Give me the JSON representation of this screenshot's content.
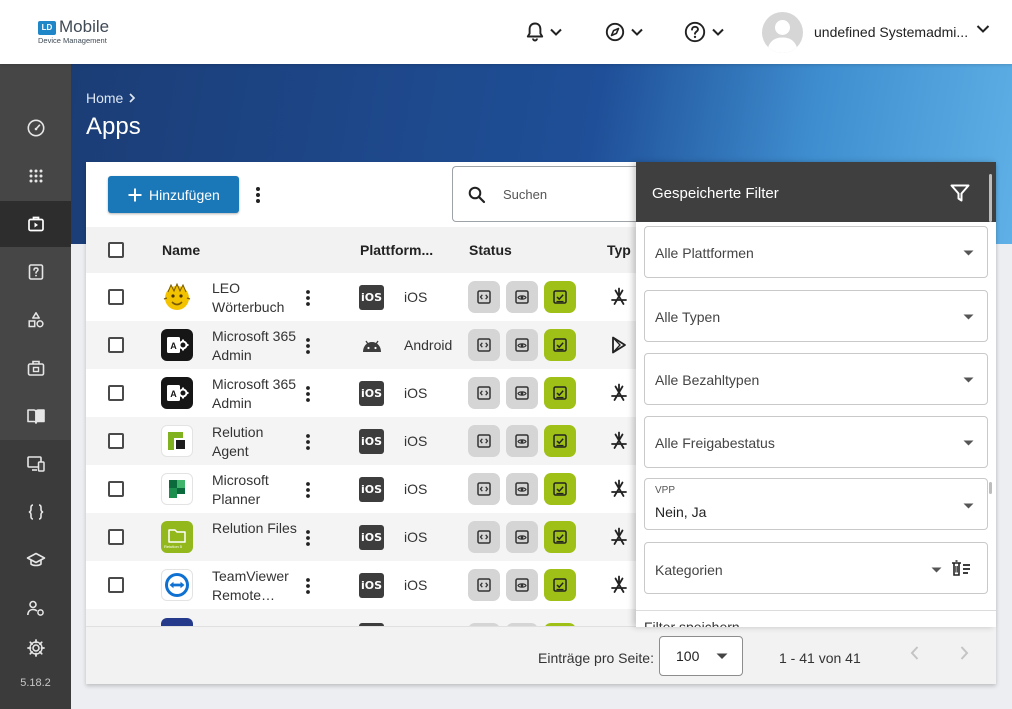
{
  "brand": {
    "logo_mark": "LD",
    "name": "Mobile",
    "subtitle": "Device Management"
  },
  "topbar": {
    "notifications_icon": "bell-icon",
    "compass_icon": "compass-icon",
    "help_icon": "help-icon",
    "user_name": "undefined Systemadmi..."
  },
  "sidebar": {
    "items": [
      {
        "name": "dashboard",
        "icon": "speedometer-icon"
      },
      {
        "name": "apps-grid",
        "icon": "grid-icon"
      },
      {
        "name": "apps",
        "icon": "app-store-icon",
        "active": true
      },
      {
        "name": "questions",
        "icon": "question-box-icon"
      },
      {
        "name": "shapes",
        "icon": "shapes-icon"
      },
      {
        "name": "briefcase",
        "icon": "briefcase-icon"
      },
      {
        "name": "book",
        "icon": "book-icon"
      },
      {
        "name": "devices",
        "icon": "device-icon"
      },
      {
        "name": "code",
        "icon": "braces-icon"
      },
      {
        "name": "education",
        "icon": "graduation-cap-icon"
      },
      {
        "name": "users",
        "icon": "users-icon"
      },
      {
        "name": "settings",
        "icon": "gear-icon"
      }
    ],
    "version": "5.18.2"
  },
  "header": {
    "breadcrumb_home": "Home",
    "title": "Apps"
  },
  "toolbar": {
    "add_label": "Hinzufügen",
    "search_placeholder": "Suchen"
  },
  "table": {
    "columns": {
      "name": "Name",
      "platform": "Plattform...",
      "status": "Status",
      "type": "Typ"
    },
    "rows": [
      {
        "name": "LEO Wörterbuch",
        "platform_badge": "iOS",
        "platform": "iOS",
        "type_icon": "app-store-icon",
        "app_icon": "leo-icon"
      },
      {
        "name": "Microsoft 365 Admin",
        "platform_badge": "",
        "platform": "Android",
        "type_icon": "play-store-icon",
        "app_icon": "ms365-admin-icon"
      },
      {
        "name": "Microsoft 365 Admin",
        "platform_badge": "iOS",
        "platform": "iOS",
        "type_icon": "app-store-icon",
        "app_icon": "ms365-admin-icon"
      },
      {
        "name": "Relution Agent",
        "platform_badge": "iOS",
        "platform": "iOS",
        "type_icon": "app-store-icon",
        "app_icon": "relution-agent-icon"
      },
      {
        "name": "Microsoft Planner",
        "platform_badge": "iOS",
        "platform": "iOS",
        "type_icon": "app-store-icon",
        "app_icon": "planner-icon"
      },
      {
        "name": "Relution Files",
        "platform_badge": "iOS",
        "platform": "iOS",
        "type_icon": "app-store-icon",
        "app_icon": "relution-files-icon",
        "app_icon_caption": "Relution 5"
      },
      {
        "name": "TeamViewer Remote…",
        "platform_badge": "iOS",
        "platform": "iOS",
        "type_icon": "app-store-icon",
        "app_icon": "teamviewer-icon"
      }
    ]
  },
  "pagination": {
    "per_page_label": "Einträge pro Seite:",
    "per_page_value": "100",
    "range": "1 - 41 von 41"
  },
  "filter_panel": {
    "title": "Gespeicherte Filter",
    "platforms": "Alle Plattformen",
    "types": "Alle Typen",
    "payment_types": "Alle Bezahltypen",
    "release_status": "Alle Freigabestatus",
    "vpp_label": "VPP",
    "vpp_value": "Nein, Ja",
    "categories": "Kategorien",
    "bottom_text": "Filter speichern"
  },
  "colors": {
    "accent": "#1a78b8",
    "status_green": "#9fc016",
    "sidebar": "#464646"
  }
}
